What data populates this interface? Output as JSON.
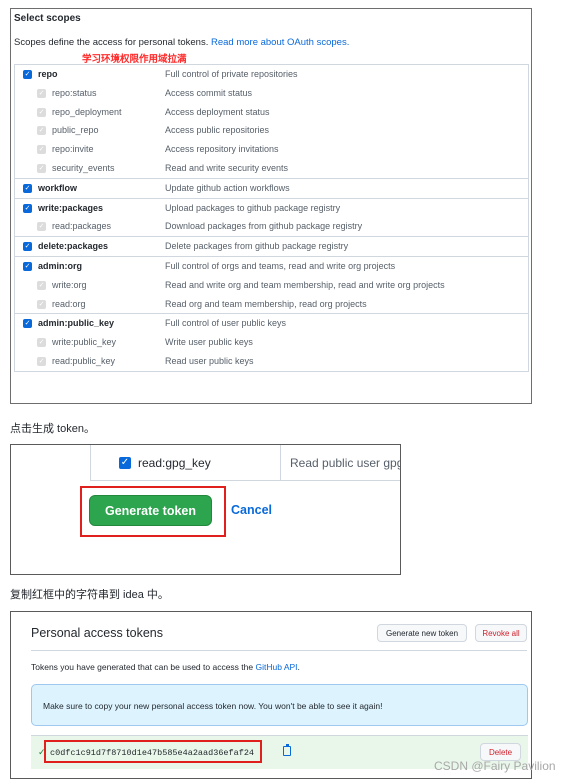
{
  "scopes": {
    "title": "Select scopes",
    "description": "Scopes define the access for personal tokens. ",
    "link": "Read more about OAuth scopes.",
    "red_note": "学习环境权限作用域拉满",
    "groups": [
      {
        "name": "repo",
        "desc": "Full control of private repositories",
        "children": [
          {
            "name": "repo:status",
            "desc": "Access commit status"
          },
          {
            "name": "repo_deployment",
            "desc": "Access deployment status"
          },
          {
            "name": "public_repo",
            "desc": "Access public repositories"
          },
          {
            "name": "repo:invite",
            "desc": "Access repository invitations"
          },
          {
            "name": "security_events",
            "desc": "Read and write security events"
          }
        ]
      },
      {
        "name": "workflow",
        "desc": "Update github action workflows",
        "children": []
      },
      {
        "name": "write:packages",
        "desc": "Upload packages to github package registry",
        "children": [
          {
            "name": "read:packages",
            "desc": "Download packages from github package registry"
          }
        ]
      },
      {
        "name": "delete:packages",
        "desc": "Delete packages from github package registry",
        "children": []
      },
      {
        "name": "admin:org",
        "desc": "Full control of orgs and teams, read and write org projects",
        "children": [
          {
            "name": "write:org",
            "desc": "Read and write org and team membership, read and write org projects"
          },
          {
            "name": "read:org",
            "desc": "Read org and team membership, read org projects"
          }
        ]
      },
      {
        "name": "admin:public_key",
        "desc": "Full control of user public keys",
        "children": [
          {
            "name": "write:public_key",
            "desc": "Write user public keys"
          },
          {
            "name": "read:public_key",
            "desc": "Read user public keys"
          }
        ]
      }
    ]
  },
  "caption1": "点击生成 token。",
  "generate": {
    "scope_name": "read:gpg_key",
    "scope_desc": "Read public user gpg",
    "button": "Generate token",
    "cancel": "Cancel"
  },
  "caption2": "复制红框中的字符串到 idea 中。",
  "tokens": {
    "title": "Personal access tokens",
    "generate_new": "Generate new token",
    "revoke_all": "Revoke all",
    "info": "Tokens you have generated that can be used to access the ",
    "info_link": "GitHub API",
    "info_end": ".",
    "flash": "Make sure to copy your new personal access token now. You won't be able to see it again!",
    "token_value": "c0dfc1c91d7f8710d1e47b585e4a2aad36efaf24",
    "delete": "Delete"
  },
  "watermark": "CSDN @Fairy Pavilion",
  "colors": {
    "accent": "#0969da",
    "green": "#2da44e",
    "red_box": "#e0201c",
    "note_red": "#ff2a2a"
  }
}
